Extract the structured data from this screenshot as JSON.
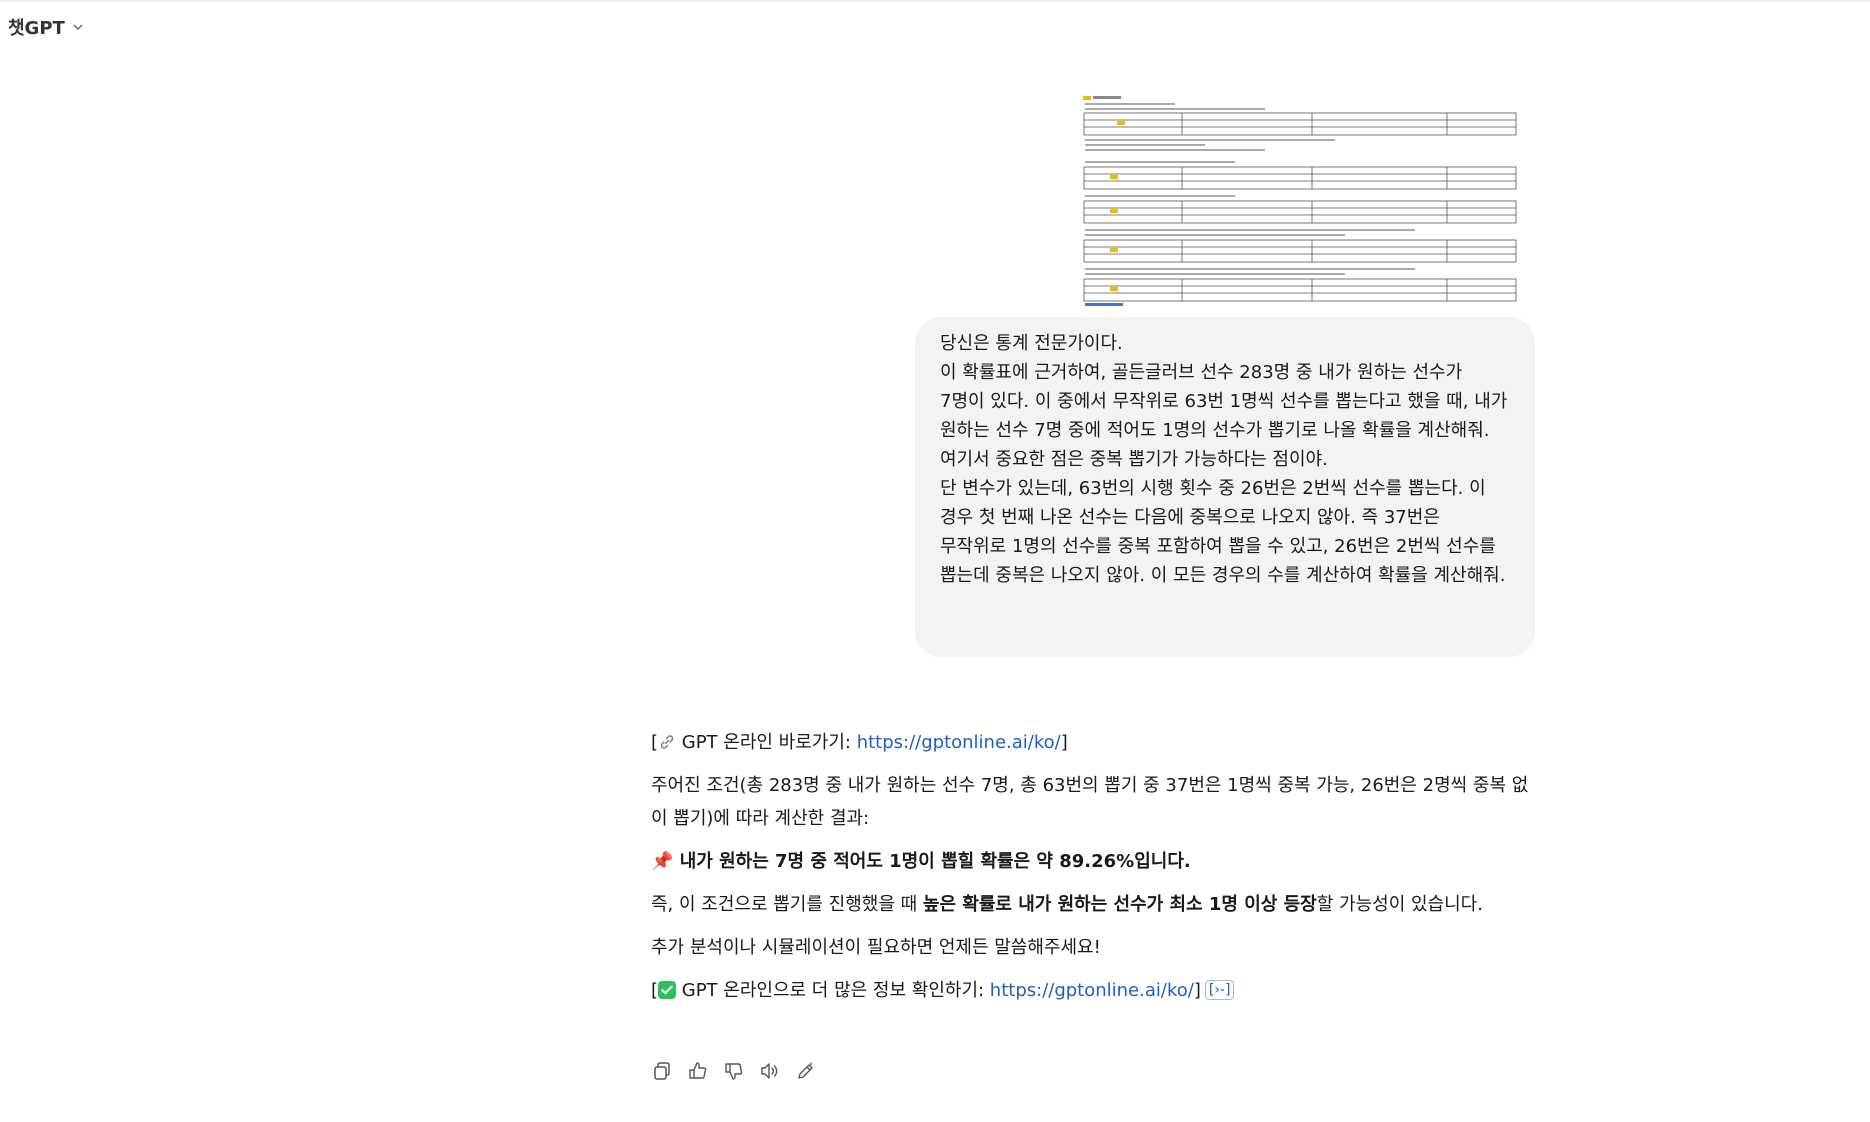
{
  "header": {
    "model_name": "챗GPT"
  },
  "user_message": {
    "lines": [
      "당신은 통계 전문가이다.",
      "이 확률표에 근거하여, 골든글러브 선수 283명 중 내가 원하는 선수가 7명이 있다. 이 중에서 무작위로 63번 1명씩 선수를 뽑는다고 했을 때, 내가 원하는 선수 7명 중에 적어도 1명의 선수가 뽑기로 나올 확률을 계산해줘. 여기서 중요한 점은 중복 뽑기가 가능하다는 점이야.",
      "단 변수가 있는데, 63번의 시행 횟수 중 26번은 2번씩 선수를 뽑는다. 이 경우 첫 번째 나온 선수는 다음에 중복으로 나오지 않아. 즉 37번은 무작위로 1명의 선수를 중복 포함하여 뽑을 수 있고, 26번은 2번씩 선수를 뽑는데 중복은 나오지 않아. 이 모든 경우의 수를 계산하여 확률을 계산해줘."
    ]
  },
  "response": {
    "shortcut_prefix": "[",
    "shortcut_text": " GPT 온라인 바로가기: ",
    "shortcut_url": "https://gptonline.ai/ko/",
    "shortcut_suffix": "]",
    "summary": "주어진 조건(총 283명 중 내가 원하는 선수 7명, 총 63번의 뽑기 중 37번은 1명씩 중복 가능, 26번은 2명씩 중복 없이 뽑기)에 따라 계산한 결과:",
    "result": "내가 원하는 7명 중 적어도 1명이 뽑힐 확률은 약 89.26%입니다.",
    "conclusion_pre": "즉, 이 조건으로 뽑기를 진행했을 때 ",
    "conclusion_bold": "높은 확률로 내가 원하는 선수가 최소 1명 이상 등장",
    "conclusion_post": "할 가능성이 있습니다.",
    "offer": "추가 분석이나 시뮬레이션이 필요하면 언제든 말씀해주세요!",
    "more_prefix": "[",
    "more_text": " GPT 온라인으로 더 많은 정보 확인하기: ",
    "more_url": "https://gptonline.ai/ko/",
    "more_suffix": "]",
    "cite_label": "[›-]"
  },
  "actions": {
    "copy": "copy-icon",
    "like": "thumbs-up-icon",
    "dislike": "thumbs-down-icon",
    "read_aloud": "speaker-icon",
    "edit": "edit-icon"
  },
  "colors": {
    "bubble_bg": "#f3f3f3",
    "link": "#1f5fc4",
    "check_green": "#2fbf5a"
  }
}
